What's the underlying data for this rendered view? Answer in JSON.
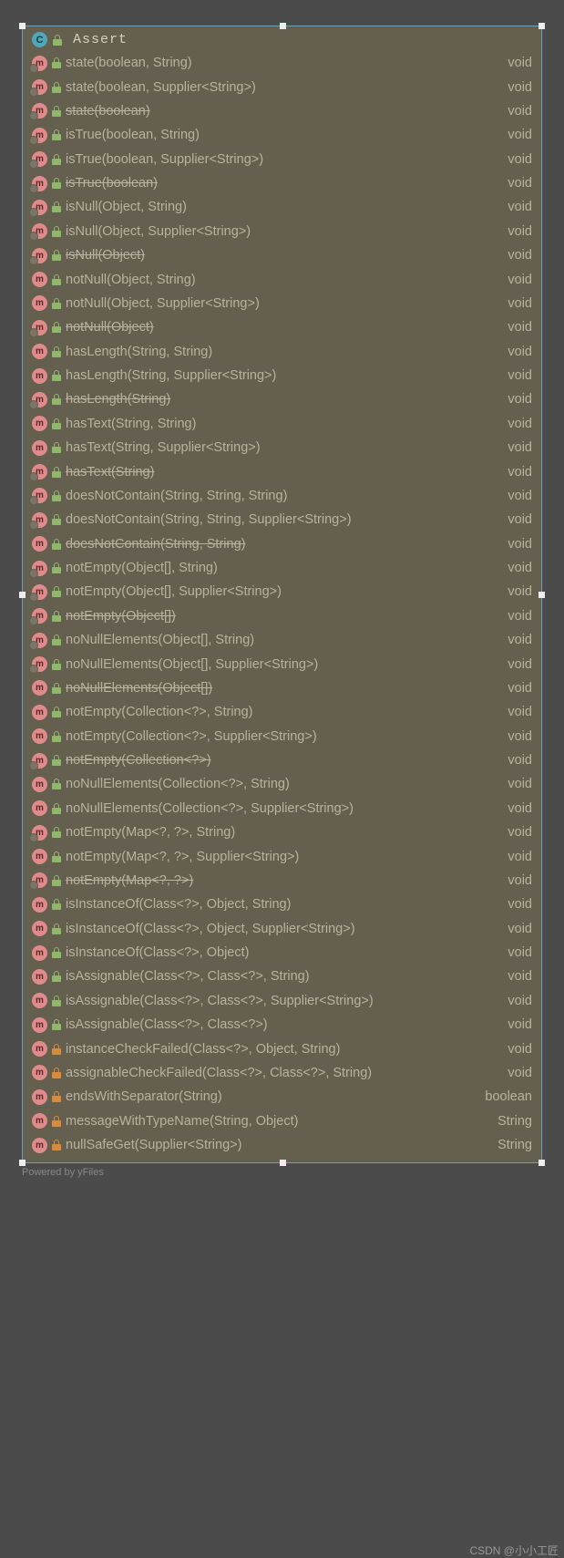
{
  "class_name": "Assert",
  "footer": "Powered by yFiles",
  "watermark": "CSDN @小小工匠",
  "members": [
    {
      "sig": "state(boolean, String)",
      "ret": "void",
      "override": true,
      "lock": "green",
      "dep": false
    },
    {
      "sig": "state(boolean, Supplier<String>)",
      "ret": "void",
      "override": true,
      "lock": "green",
      "dep": false
    },
    {
      "sig": "state(boolean)",
      "ret": "void",
      "override": true,
      "lock": "green",
      "dep": true
    },
    {
      "sig": "isTrue(boolean, String)",
      "ret": "void",
      "override": true,
      "lock": "green",
      "dep": false
    },
    {
      "sig": "isTrue(boolean, Supplier<String>)",
      "ret": "void",
      "override": true,
      "lock": "green",
      "dep": false
    },
    {
      "sig": "isTrue(boolean)",
      "ret": "void",
      "override": true,
      "lock": "green",
      "dep": true
    },
    {
      "sig": "isNull(Object, String)",
      "ret": "void",
      "override": true,
      "lock": "green",
      "dep": false
    },
    {
      "sig": "isNull(Object, Supplier<String>)",
      "ret": "void",
      "override": true,
      "lock": "green",
      "dep": false
    },
    {
      "sig": "isNull(Object)",
      "ret": "void",
      "override": true,
      "lock": "green",
      "dep": true
    },
    {
      "sig": "notNull(Object, String)",
      "ret": "void",
      "override": false,
      "lock": "green",
      "dep": false
    },
    {
      "sig": "notNull(Object, Supplier<String>)",
      "ret": "void",
      "override": false,
      "lock": "green",
      "dep": false
    },
    {
      "sig": "notNull(Object)",
      "ret": "void",
      "override": true,
      "lock": "green",
      "dep": true
    },
    {
      "sig": "hasLength(String, String)",
      "ret": "void",
      "override": false,
      "lock": "green",
      "dep": false
    },
    {
      "sig": "hasLength(String, Supplier<String>)",
      "ret": "void",
      "override": false,
      "lock": "green",
      "dep": false
    },
    {
      "sig": "hasLength(String)",
      "ret": "void",
      "override": true,
      "lock": "green",
      "dep": true
    },
    {
      "sig": "hasText(String, String)",
      "ret": "void",
      "override": false,
      "lock": "green",
      "dep": false
    },
    {
      "sig": "hasText(String, Supplier<String>)",
      "ret": "void",
      "override": false,
      "lock": "green",
      "dep": false
    },
    {
      "sig": "hasText(String)",
      "ret": "void",
      "override": true,
      "lock": "green",
      "dep": true
    },
    {
      "sig": "doesNotContain(String, String, String)",
      "ret": "void",
      "override": true,
      "lock": "green",
      "dep": false
    },
    {
      "sig": "doesNotContain(String, String, Supplier<String>)",
      "ret": "void",
      "override": true,
      "lock": "green",
      "dep": false
    },
    {
      "sig": "doesNotContain(String, String)",
      "ret": "void",
      "override": false,
      "lock": "green",
      "dep": true
    },
    {
      "sig": "notEmpty(Object[], String)",
      "ret": "void",
      "override": true,
      "lock": "green",
      "dep": false
    },
    {
      "sig": "notEmpty(Object[], Supplier<String>)",
      "ret": "void",
      "override": true,
      "lock": "green",
      "dep": false
    },
    {
      "sig": "notEmpty(Object[])",
      "ret": "void",
      "override": true,
      "lock": "green",
      "dep": true
    },
    {
      "sig": "noNullElements(Object[], String)",
      "ret": "void",
      "override": true,
      "lock": "green",
      "dep": false
    },
    {
      "sig": "noNullElements(Object[], Supplier<String>)",
      "ret": "void",
      "override": true,
      "lock": "green",
      "dep": false
    },
    {
      "sig": "noNullElements(Object[])",
      "ret": "void",
      "override": false,
      "lock": "green",
      "dep": true
    },
    {
      "sig": "notEmpty(Collection<?>, String)",
      "ret": "void",
      "override": false,
      "lock": "green",
      "dep": false
    },
    {
      "sig": "notEmpty(Collection<?>, Supplier<String>)",
      "ret": "void",
      "override": false,
      "lock": "green",
      "dep": false
    },
    {
      "sig": "notEmpty(Collection<?>)",
      "ret": "void",
      "override": true,
      "lock": "green",
      "dep": true
    },
    {
      "sig": "noNullElements(Collection<?>, String)",
      "ret": "void",
      "override": false,
      "lock": "green",
      "dep": false
    },
    {
      "sig": "noNullElements(Collection<?>, Supplier<String>)",
      "ret": "void",
      "override": false,
      "lock": "green",
      "dep": false
    },
    {
      "sig": "notEmpty(Map<?, ?>, String)",
      "ret": "void",
      "override": true,
      "lock": "green",
      "dep": false
    },
    {
      "sig": "notEmpty(Map<?, ?>, Supplier<String>)",
      "ret": "void",
      "override": false,
      "lock": "green",
      "dep": false
    },
    {
      "sig": "notEmpty(Map<?, ?>)",
      "ret": "void",
      "override": true,
      "lock": "green",
      "dep": true
    },
    {
      "sig": "isInstanceOf(Class<?>, Object, String)",
      "ret": "void",
      "override": false,
      "lock": "green",
      "dep": false
    },
    {
      "sig": "isInstanceOf(Class<?>, Object, Supplier<String>)",
      "ret": "void",
      "override": false,
      "lock": "green",
      "dep": false
    },
    {
      "sig": "isInstanceOf(Class<?>, Object)",
      "ret": "void",
      "override": false,
      "lock": "green",
      "dep": false
    },
    {
      "sig": "isAssignable(Class<?>, Class<?>, String)",
      "ret": "void",
      "override": false,
      "lock": "green",
      "dep": false
    },
    {
      "sig": "isAssignable(Class<?>, Class<?>, Supplier<String>)",
      "ret": "void",
      "override": false,
      "lock": "green",
      "dep": false
    },
    {
      "sig": "isAssignable(Class<?>, Class<?>)",
      "ret": "void",
      "override": false,
      "lock": "green",
      "dep": false
    },
    {
      "sig": "instanceCheckFailed(Class<?>, Object, String)",
      "ret": "void",
      "override": false,
      "lock": "orange",
      "dep": false
    },
    {
      "sig": "assignableCheckFailed(Class<?>, Class<?>, String)",
      "ret": "void",
      "override": false,
      "lock": "orange",
      "dep": false
    },
    {
      "sig": "endsWithSeparator(String)",
      "ret": "boolean",
      "override": false,
      "lock": "orange",
      "dep": false
    },
    {
      "sig": "messageWithTypeName(String, Object)",
      "ret": "String",
      "override": false,
      "lock": "orange",
      "dep": false
    },
    {
      "sig": "nullSafeGet(Supplier<String>)",
      "ret": "String",
      "override": false,
      "lock": "orange",
      "dep": false
    }
  ]
}
